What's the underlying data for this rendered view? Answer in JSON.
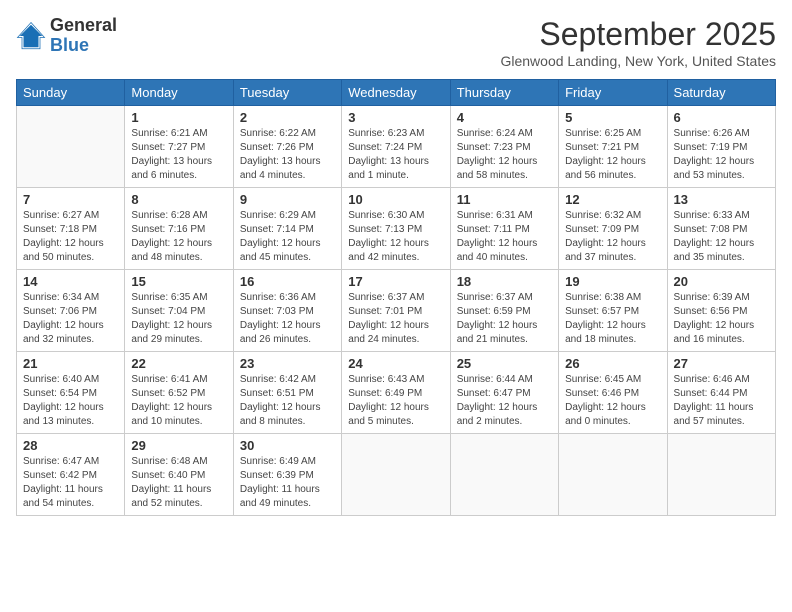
{
  "header": {
    "logo_line1": "General",
    "logo_line2": "Blue",
    "month_year": "September 2025",
    "location": "Glenwood Landing, New York, United States"
  },
  "days_of_week": [
    "Sunday",
    "Monday",
    "Tuesday",
    "Wednesday",
    "Thursday",
    "Friday",
    "Saturday"
  ],
  "weeks": [
    [
      {
        "day": "",
        "info": ""
      },
      {
        "day": "1",
        "info": "Sunrise: 6:21 AM\nSunset: 7:27 PM\nDaylight: 13 hours\nand 6 minutes."
      },
      {
        "day": "2",
        "info": "Sunrise: 6:22 AM\nSunset: 7:26 PM\nDaylight: 13 hours\nand 4 minutes."
      },
      {
        "day": "3",
        "info": "Sunrise: 6:23 AM\nSunset: 7:24 PM\nDaylight: 13 hours\nand 1 minute."
      },
      {
        "day": "4",
        "info": "Sunrise: 6:24 AM\nSunset: 7:23 PM\nDaylight: 12 hours\nand 58 minutes."
      },
      {
        "day": "5",
        "info": "Sunrise: 6:25 AM\nSunset: 7:21 PM\nDaylight: 12 hours\nand 56 minutes."
      },
      {
        "day": "6",
        "info": "Sunrise: 6:26 AM\nSunset: 7:19 PM\nDaylight: 12 hours\nand 53 minutes."
      }
    ],
    [
      {
        "day": "7",
        "info": "Sunrise: 6:27 AM\nSunset: 7:18 PM\nDaylight: 12 hours\nand 50 minutes."
      },
      {
        "day": "8",
        "info": "Sunrise: 6:28 AM\nSunset: 7:16 PM\nDaylight: 12 hours\nand 48 minutes."
      },
      {
        "day": "9",
        "info": "Sunrise: 6:29 AM\nSunset: 7:14 PM\nDaylight: 12 hours\nand 45 minutes."
      },
      {
        "day": "10",
        "info": "Sunrise: 6:30 AM\nSunset: 7:13 PM\nDaylight: 12 hours\nand 42 minutes."
      },
      {
        "day": "11",
        "info": "Sunrise: 6:31 AM\nSunset: 7:11 PM\nDaylight: 12 hours\nand 40 minutes."
      },
      {
        "day": "12",
        "info": "Sunrise: 6:32 AM\nSunset: 7:09 PM\nDaylight: 12 hours\nand 37 minutes."
      },
      {
        "day": "13",
        "info": "Sunrise: 6:33 AM\nSunset: 7:08 PM\nDaylight: 12 hours\nand 35 minutes."
      }
    ],
    [
      {
        "day": "14",
        "info": "Sunrise: 6:34 AM\nSunset: 7:06 PM\nDaylight: 12 hours\nand 32 minutes."
      },
      {
        "day": "15",
        "info": "Sunrise: 6:35 AM\nSunset: 7:04 PM\nDaylight: 12 hours\nand 29 minutes."
      },
      {
        "day": "16",
        "info": "Sunrise: 6:36 AM\nSunset: 7:03 PM\nDaylight: 12 hours\nand 26 minutes."
      },
      {
        "day": "17",
        "info": "Sunrise: 6:37 AM\nSunset: 7:01 PM\nDaylight: 12 hours\nand 24 minutes."
      },
      {
        "day": "18",
        "info": "Sunrise: 6:37 AM\nSunset: 6:59 PM\nDaylight: 12 hours\nand 21 minutes."
      },
      {
        "day": "19",
        "info": "Sunrise: 6:38 AM\nSunset: 6:57 PM\nDaylight: 12 hours\nand 18 minutes."
      },
      {
        "day": "20",
        "info": "Sunrise: 6:39 AM\nSunset: 6:56 PM\nDaylight: 12 hours\nand 16 minutes."
      }
    ],
    [
      {
        "day": "21",
        "info": "Sunrise: 6:40 AM\nSunset: 6:54 PM\nDaylight: 12 hours\nand 13 minutes."
      },
      {
        "day": "22",
        "info": "Sunrise: 6:41 AM\nSunset: 6:52 PM\nDaylight: 12 hours\nand 10 minutes."
      },
      {
        "day": "23",
        "info": "Sunrise: 6:42 AM\nSunset: 6:51 PM\nDaylight: 12 hours\nand 8 minutes."
      },
      {
        "day": "24",
        "info": "Sunrise: 6:43 AM\nSunset: 6:49 PM\nDaylight: 12 hours\nand 5 minutes."
      },
      {
        "day": "25",
        "info": "Sunrise: 6:44 AM\nSunset: 6:47 PM\nDaylight: 12 hours\nand 2 minutes."
      },
      {
        "day": "26",
        "info": "Sunrise: 6:45 AM\nSunset: 6:46 PM\nDaylight: 12 hours\nand 0 minutes."
      },
      {
        "day": "27",
        "info": "Sunrise: 6:46 AM\nSunset: 6:44 PM\nDaylight: 11 hours\nand 57 minutes."
      }
    ],
    [
      {
        "day": "28",
        "info": "Sunrise: 6:47 AM\nSunset: 6:42 PM\nDaylight: 11 hours\nand 54 minutes."
      },
      {
        "day": "29",
        "info": "Sunrise: 6:48 AM\nSunset: 6:40 PM\nDaylight: 11 hours\nand 52 minutes."
      },
      {
        "day": "30",
        "info": "Sunrise: 6:49 AM\nSunset: 6:39 PM\nDaylight: 11 hours\nand 49 minutes."
      },
      {
        "day": "",
        "info": ""
      },
      {
        "day": "",
        "info": ""
      },
      {
        "day": "",
        "info": ""
      },
      {
        "day": "",
        "info": ""
      }
    ]
  ]
}
